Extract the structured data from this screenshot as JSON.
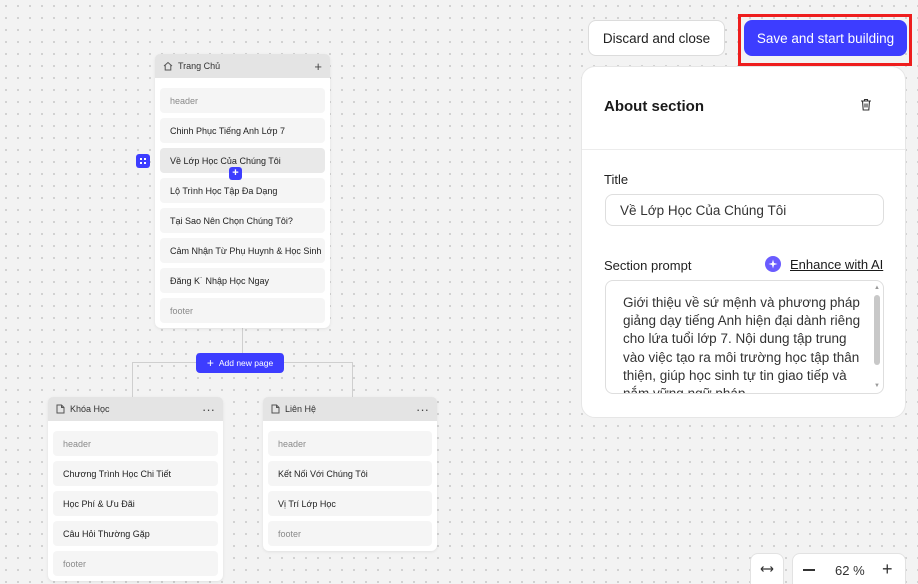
{
  "toolbar": {
    "discard_label": "Discard and close",
    "save_label": "Save and start building"
  },
  "sitemap": {
    "home": {
      "title": "Trang Chủ",
      "sections": [
        "header",
        "Chinh Phục Tiếng Anh Lớp 7",
        "Về Lớp Học Của Chúng Tôi",
        "Lộ Trình Học Tập Đa Dạng",
        "Tại Sao Nên Chọn Chúng Tôi?",
        "Cảm Nhận Từ Phụ Huynh & Học Sinh",
        "Đăng K˙ Nhập Học Ngay",
        "footer"
      ]
    },
    "add_page_label": "Add new page",
    "khoa_hoc": {
      "title": "Khóa Học",
      "sections": [
        "header",
        "Chương Trình Học Chi Tiết",
        "Học Phí & Ưu Đãi",
        "Câu Hỏi Thường Gặp",
        "footer"
      ]
    },
    "lien_he": {
      "title": "Liên Hệ",
      "sections": [
        "header",
        "Kết Nối Với Chúng Tôi",
        "Vị Trí Lớp Học",
        "footer"
      ]
    }
  },
  "panel": {
    "heading": "About section",
    "title_label": "Title",
    "title_value": "Về Lớp Học Của Chúng Tôi",
    "prompt_label": "Section prompt",
    "enhance_label": "Enhance with AI",
    "prompt_value": "Giới thiệu về sứ mệnh và phương pháp giảng dạy tiếng Anh hiện đại dành riêng cho lứa tuổi lớp 7. Nội dung tập trung vào việc tạo ra môi trường học tập thân thiện, giúp học sinh tự tin giao tiếp và nắm vững ngữ pháp."
  },
  "zoom": {
    "value": "62 %"
  },
  "icons": {
    "home": "home-icon",
    "page": "page-icon",
    "trash": "trash-icon",
    "ai": "sparkle-icon",
    "fit": "fit-width-icon"
  },
  "colors": {
    "accent": "#3d3dff",
    "highlight": "#ee1d1d"
  }
}
